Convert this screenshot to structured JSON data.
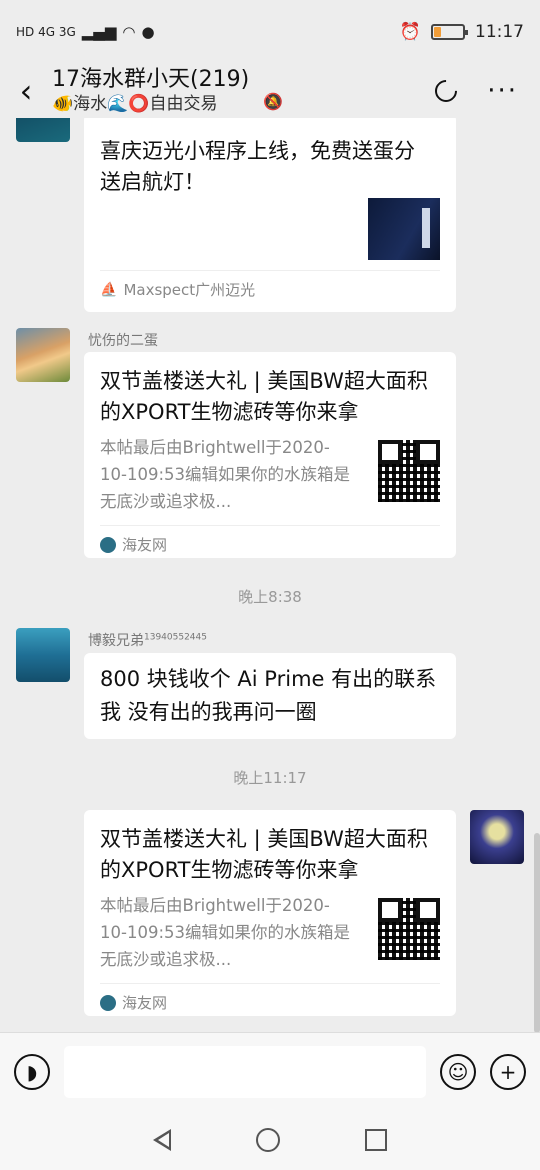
{
  "status_bar": {
    "network_labels": "HD 4G 3G",
    "time": "11:17",
    "battery_level": 0.25,
    "battery_color": "#f19d38"
  },
  "header": {
    "back_icon": "chevron-left-icon",
    "title": "17海水群小天(219)",
    "subtitle": "🐠海水🌊⭕自由交易",
    "mute_icon": "bell-off-icon",
    "right_icons": [
      "refresh-circle-icon",
      "more-icon"
    ]
  },
  "messages": [
    {
      "type": "card",
      "sender": "",
      "title": "喜庆迈光小程序上线，免费送蛋分送启航灯！",
      "source": "Maxspect广州迈光"
    },
    {
      "type": "card",
      "sender": "忧伤的二蛋",
      "title": "双节盖楼送大礼 | 美国BW超大面积的XPORT生物滤砖等你来拿",
      "description": "本帖最后由Brightwell于2020-10-109:53编辑如果你的水族箱是无底沙或追求极...",
      "source": "海友网"
    },
    {
      "type": "time",
      "text": "晚上8:38"
    },
    {
      "type": "text",
      "sender": "博毅兄弟",
      "sender_suffix": "13940552445",
      "text": "800 块钱收个 Ai Prime    有出的联系我  没有出的我再问一圈"
    },
    {
      "type": "time",
      "text": "晚上11:17"
    },
    {
      "type": "card",
      "sender": "",
      "title": "双节盖楼送大礼 | 美国BW超大面积的XPORT生物滤砖等你来拿",
      "description": "本帖最后由Brightwell于2020-10-109:53编辑如果你的水族箱是无底沙或追求极...",
      "source": "海友网"
    }
  ],
  "input_bar": {
    "voice_icon": "voice-icon",
    "text_value": "",
    "emoji_icon": "emoji-icon",
    "add_icon": "plus-icon"
  },
  "nav_bar": {
    "icons": [
      "nav-back-icon",
      "nav-home-icon",
      "nav-recent-icon"
    ]
  }
}
